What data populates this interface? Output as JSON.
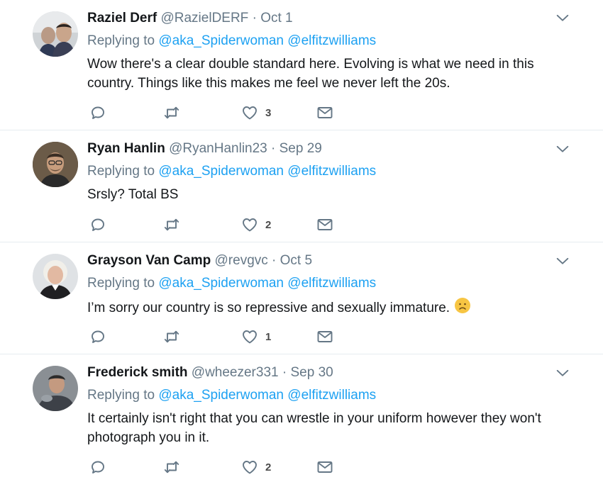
{
  "tweets": [
    {
      "name": "Raziel Derf",
      "handle": "@RazielDERF",
      "dot": "·",
      "time": "Oct 1",
      "replying_label": "Replying to",
      "mention1": "@aka_Spiderwoman",
      "mention2": "@elfitzwilliams",
      "text": "Wow there's a clear double standard here. Evolving is what we need in this country. Things like this makes me feel we never left the 20s.",
      "likes": "3"
    },
    {
      "name": "Ryan Hanlin",
      "handle": "@RyanHanlin23",
      "dot": "·",
      "time": "Sep 29",
      "replying_label": "Replying to",
      "mention1": "@aka_Spiderwoman",
      "mention2": "@elfitzwilliams",
      "text": "Srsly? Total BS",
      "likes": "2"
    },
    {
      "name": "Grayson Van Camp",
      "handle": "@revgvc",
      "dot": "·",
      "time": "Oct 5",
      "replying_label": "Replying to",
      "mention1": "@aka_Spiderwoman",
      "mention2": "@elfitzwilliams",
      "text": "I’m sorry our country is so repressive and sexually immature.",
      "emoji": "frowning-face",
      "likes": "1"
    },
    {
      "name": "Frederick smith",
      "handle": "@wheezer331",
      "dot": "·",
      "time": "Sep 30",
      "replying_label": "Replying to",
      "mention1": "@aka_Spiderwoman",
      "mention2": "@elfitzwilliams",
      "text": "It certainly isn't right that you can wrestle in your uniform however they won't photograph you in it.",
      "likes": "2"
    }
  ],
  "icons": {
    "reply": "reply-icon",
    "retweet": "retweet-icon",
    "like": "heart-icon",
    "dm": "envelope-icon",
    "more": "chevron-down-icon"
  },
  "colors": {
    "name": "#14171a",
    "secondary": "#657786",
    "link": "#1da1f2",
    "divider": "#e6ecf0"
  }
}
